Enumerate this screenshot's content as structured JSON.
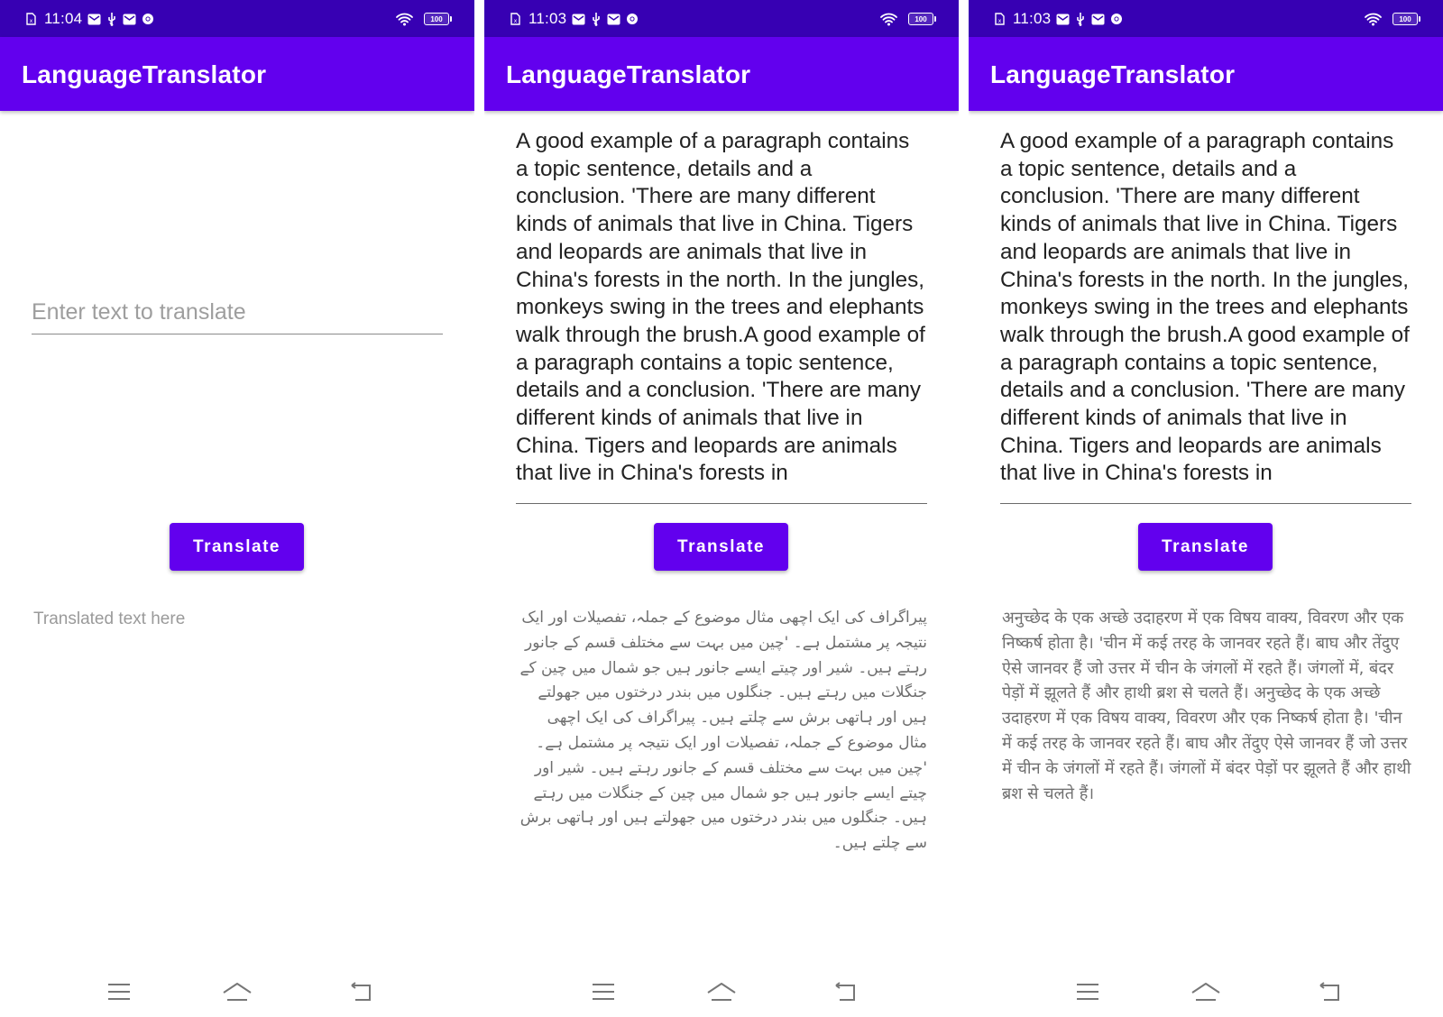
{
  "colors": {
    "status_bar": "#3700b3",
    "app_bar": "#6200ee",
    "button": "#6200ee",
    "button_text": "#ffffff"
  },
  "screens": [
    {
      "status": {
        "time": "11:04",
        "battery": "100"
      },
      "app_title": "LanguageTranslator",
      "input": {
        "value": "",
        "placeholder": "Enter text to translate"
      },
      "button_label": "Translate",
      "output": {
        "text": "",
        "placeholder": "Translated text here"
      }
    },
    {
      "status": {
        "time": "11:03",
        "battery": "100"
      },
      "app_title": "LanguageTranslator",
      "input": {
        "value": "A good example of a paragraph contains a topic sentence, details and a conclusion. 'There are many different kinds of animals that live in China. Tigers and leopards are animals that live in China's forests in the north. In the jungles, monkeys swing in the trees and elephants walk through the brush.A good example of a paragraph contains a topic sentence, details and a conclusion. 'There are many different kinds of animals that live in China. Tigers and leopards are animals that live in China's forests in",
        "placeholder": "Enter text to translate"
      },
      "button_label": "Translate",
      "output": {
        "text": "پیراگراف کی ایک اچھی مثال موضوع کے جملہ، تفصیلات اور ایک نتیجہ پر مشتمل ہے۔ 'چین میں بہت سے مختلف قسم کے جانور رہتے ہیں۔ شیر اور چیتے ایسے جانور ہیں جو شمال میں چین کے جنگلات میں رہتے ہیں۔ جنگلوں میں بندر درختوں میں جھولتے ہیں اور ہاتھی برش سے چلتے ہیں۔ پیراگراف کی ایک اچھی مثال موضوع کے جملہ، تفصیلات اور ایک نتیجہ پر مشتمل ہے۔ 'چین میں بہت سے مختلف قسم کے جانور رہتے ہیں۔ شیر اور چیتے ایسے جانور ہیں جو شمال میں چین کے جنگلات میں رہتے ہیں۔ جنگلوں میں بندر درختوں میں جھولتے ہیں اور ہاتھی برش سے چلتے ہیں۔",
        "placeholder": "Translated text here"
      }
    },
    {
      "status": {
        "time": "11:03",
        "battery": "100"
      },
      "app_title": "LanguageTranslator",
      "input": {
        "value": "A good example of a paragraph contains a topic sentence, details and a conclusion. 'There are many different kinds of animals that live in China. Tigers and leopards are animals that live in China's forests in the north. In the jungles, monkeys swing in the trees and elephants walk through the brush.A good example of a paragraph contains a topic sentence, details and a conclusion. 'There are many different kinds of animals that live in China. Tigers and leopards are animals that live in China's forests in",
        "placeholder": "Enter text to translate"
      },
      "button_label": "Translate",
      "output": {
        "text": "अनुच्छेद के एक अच्छे उदाहरण में एक विषय वाक्य, विवरण और एक निष्कर्ष होता है। 'चीन में कई तरह के जानवर रहते हैं। बाघ और तेंदुए ऐसे जानवर हैं जो उत्तर में चीन के जंगलों में रहते हैं। जंगलों में, बंदर पेड़ों में झूलते हैं और हाथी ब्रश से चलते हैं। अनुच्छेद के एक अच्छे उदाहरण में एक विषय वाक्य, विवरण और एक निष्कर्ष होता है। 'चीन में कई तरह के जानवर रहते हैं। बाघ और तेंदुए ऐसे जानवर हैं जो उत्तर में चीन के जंगलों में रहते हैं। जंगलों में बंदर पेड़ों पर झूलते हैं और हाथी ब्रश से चलते हैं।",
        "placeholder": "Translated text here"
      }
    }
  ]
}
